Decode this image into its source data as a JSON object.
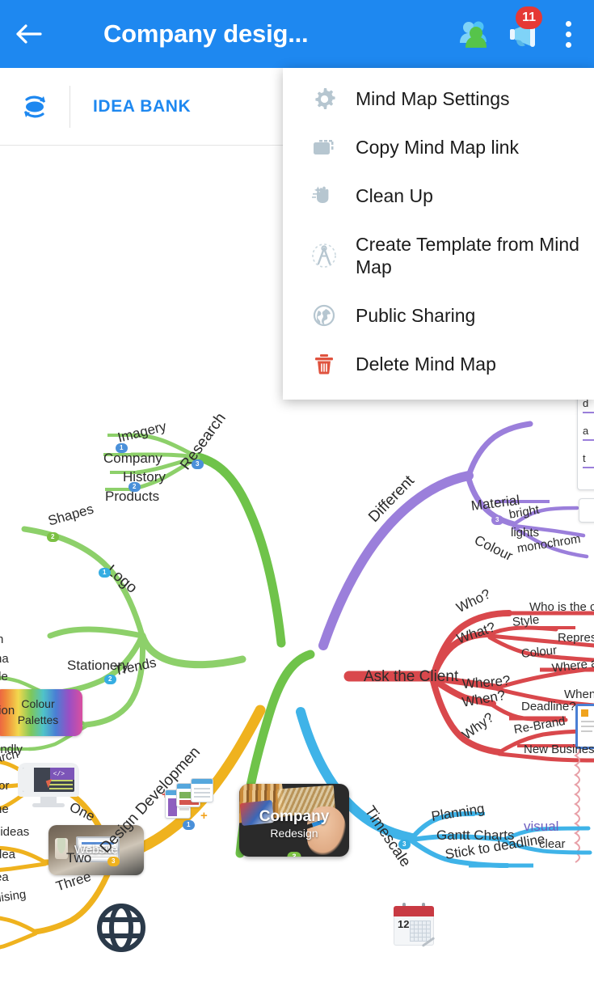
{
  "appbar": {
    "back_icon": "back-arrow-icon",
    "title": "Company desig...",
    "people_icon": "people-share-icon",
    "announce_icon": "megaphone-icon",
    "notification_count": "11",
    "overflow_icon": "kebab-menu-icon"
  },
  "subbar": {
    "refresh_icon": "sync-rotate-icon",
    "label": "IDEA BANK"
  },
  "menu": {
    "items": [
      {
        "label": "Mind Map Settings",
        "icon": "gear-icon",
        "icon_color": "#B6C6D0"
      },
      {
        "label": "Copy Mind Map link",
        "icon": "copy-link-icon",
        "icon_color": "#B6C6D0"
      },
      {
        "label": "Clean Up",
        "icon": "clean-up-icon",
        "icon_color": "#B6C6D0"
      },
      {
        "label": "Create Template from Mind Map",
        "icon": "compass-icon",
        "icon_color": "#B6C6D0"
      },
      {
        "label": "Public Sharing",
        "icon": "globe-icon",
        "icon_color": "#B6C6D0"
      },
      {
        "label": "Delete Mind Map",
        "icon": "trash-icon",
        "icon_color": "#E0533F"
      }
    ]
  },
  "mindmap": {
    "central": {
      "title": "Company",
      "subtitle": "Redesign",
      "badge": "3"
    },
    "branches": {
      "research": {
        "label": "Research",
        "color": "#6FC34A",
        "badge": "3",
        "children": [
          "Imagery",
          "Company",
          "History",
          "Products"
        ]
      },
      "logo": {
        "label": "Logo",
        "color": "#8DD06A",
        "badge": "1",
        "children": [
          "Shapes",
          "Colour Palettes",
          "Trends",
          "Stationery",
          "Website"
        ]
      },
      "different": {
        "label": "Different",
        "color": "#9B7FDB",
        "children": [
          "Material",
          "Colour",
          "bright",
          "lights",
          "monochrom"
        ]
      },
      "ask_client": {
        "label": "Ask the Client",
        "color": "#D9484C",
        "children": [
          "Who?",
          "What?",
          "Where?",
          "When?",
          "Why?",
          "Who is the cli",
          "Style",
          "Represe",
          "Colour",
          "Where a",
          "When",
          "Deadline?",
          "Re-Brand",
          "New Business"
        ]
      },
      "timescale": {
        "label": "Timescale",
        "color": "#3FB3E8",
        "badge": "3",
        "children": [
          "Planning",
          "Gantt Charts",
          "Stick to deadline",
          "visual",
          "clear"
        ]
      },
      "design_dev": {
        "label": "Design Developmen",
        "color": "#EFB21E",
        "badge": "3",
        "children": [
          "One",
          "Two",
          "Three",
          "arch",
          "tor",
          "he",
          "t ideas",
          "dea",
          "ea",
          "alising"
        ]
      }
    },
    "clipped_labels": {
      "left_green": [
        "n",
        "na",
        "tle",
        "tion",
        "endly"
      ],
      "edge_card_lines": [
        "d",
        "a",
        "t"
      ]
    }
  }
}
